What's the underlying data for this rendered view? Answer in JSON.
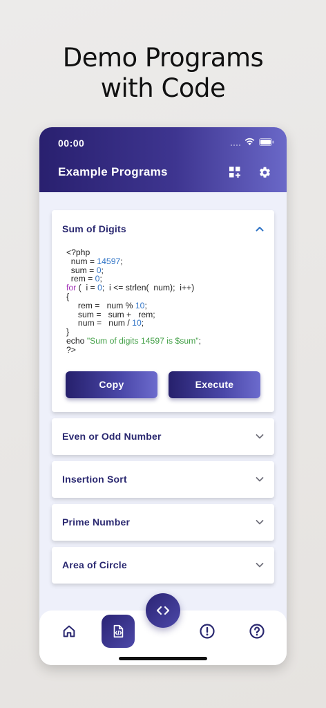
{
  "promo": {
    "line1": "Demo Programs",
    "line2": "with Code"
  },
  "status_bar": {
    "time": "00:00"
  },
  "header": {
    "title": "Example Programs",
    "add_icon": "grid-add-icon",
    "settings_icon": "gear-icon"
  },
  "programs": [
    {
      "title": "Sum of Digits",
      "expanded": true
    },
    {
      "title": "Even or Odd Number",
      "expanded": false
    },
    {
      "title": "Insertion Sort",
      "expanded": false
    },
    {
      "title": "Prime Number",
      "expanded": false
    },
    {
      "title": "Area of Circle",
      "expanded": false
    }
  ],
  "code": {
    "l1": "<?php",
    "l2_a": "  num = ",
    "l2_num": "14597",
    "l2_b": ";",
    "l3_a": "  sum = ",
    "l3_num": "0",
    "l3_b": ";",
    "l4_a": "  rem = ",
    "l4_num": "0",
    "l4_b": ";",
    "l5_kw": "for",
    "l5_a": " (  i = ",
    "l5_num": "0",
    "l5_b": ";  i <= strlen(  num);  i++)",
    "l6": "{",
    "l7_a": "     rem =   num % ",
    "l7_num": "10",
    "l7_b": ";",
    "l8": "     sum =   sum +   rem;",
    "l9_a": "     num =   num / ",
    "l9_num": "10",
    "l9_b": ";",
    "l10": "}",
    "l11_a": "echo ",
    "l11_str": "\"Sum of digits 14597 is $sum\"",
    "l11_b": ";",
    "l12": "?>"
  },
  "buttons": {
    "copy": "Copy",
    "execute": "Execute"
  },
  "bottom_nav": {
    "items": [
      "home-icon",
      "code-file-icon",
      "info-icon",
      "help-icon"
    ],
    "fab_icon": "code-brackets-icon"
  }
}
